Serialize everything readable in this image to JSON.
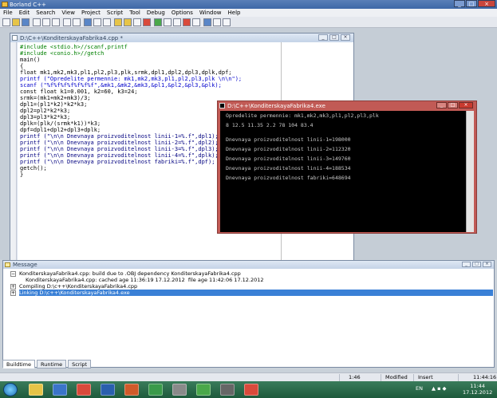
{
  "window": {
    "title": "Borland C++"
  },
  "menu": [
    "File",
    "Edit",
    "Search",
    "View",
    "Project",
    "Script",
    "Tool",
    "Debug",
    "Options",
    "Window",
    "Help"
  ],
  "editor": {
    "title": "D:\\C++\\KonditerskayaFabrika4.cpp *",
    "lines": [
      "#include <stdio.h>//scanf,printf",
      "#include <conio.h>//getch",
      "main()",
      "{",
      "float mk1,mk2,mk3,pl1,pl2,pl3,plk,srmk,dpl1,dpl2,dpl3,dplk,dpf;",
      "printf (\"Opredelite permennie: mk1,mk2,mk3,pl1,pl2,pl3,plk \\n\\n\");",
      "scanf (\"%f%f%f%f%f%f%f\",&mk1,&mk2,&mk3,&pl1,&pl2,&pl3,&plk);",
      "const float k1=0.001, k2=60, k3=24;",
      "srmk=(mk1+mk2+mk3)/3;",
      "dpl1=(pl1*k2)*k2*k3;",
      "dpl2=pl2*k2*k3;",
      "dpl3=pl3*k2*k3;",
      "dplk=(plk/(srmk*k1))*k3;",
      "dpf=dpl1+dpl2+dpl3+dplk;",
      "printf (\"\\n\\n Dnevnaya proizvoditelnost linii-1=%.f\",dpl1);",
      "printf (\"\\n\\n Dnevnaya proizvoditelnost linii-2=%.f\",dpl2);",
      "printf (\"\\n\\n Dnevnaya proizvoditelnost linii-3=%.f\",dpl3);",
      "printf (\"\\n\\n Dnevnaya proizvoditelnost linii-4=%.f\",dplk);",
      "printf (\"\\n\\n Dnevnaya proizvoditelnost fabriki=%.f\",dpf);",
      "getch();",
      "}"
    ]
  },
  "console": {
    "title": "D:\\C++\\KonditerskayaFabrika4.exe",
    "lines": [
      "Opredelite permennie: mk1,mk2,mk3,pl1,pl2,pl3,plk",
      "8 12.5 11.35 2.2 78 104 83.4",
      "Dnevnaya proizvoditelnost linii-1=198000",
      "Dnevnaya proizvoditelnost linii-2=112320",
      "Dnevnaya proizvoditelnost linii-3=149760",
      "Dnevnaya proizvoditelnost linii-4=188534",
      "Dnevnaya proizvoditelnost fabriki=648694"
    ]
  },
  "messages": {
    "title": "Message",
    "lines": [
      "KonditerskayaFabrika4.cpp: build due to .OBJ dependency KonditerskayaFabrika4.cpp",
      "KonditerskayaFabrika4.cpp: cached age 11:36:19 17.12.2012  file age 11:42:06 17.12.2012",
      "Compiling D:\\c++\\KonditerskayaFabrika4.cpp",
      "Linking D:\\c++\\KonditerskayaFabrika4.exe"
    ]
  },
  "tabs": [
    "Buildtime",
    "Runtime",
    "Script"
  ],
  "status": {
    "position": "1:46",
    "state": "Modified",
    "mode": "Insert",
    "time": "11:44:16"
  },
  "tray": {
    "lang": "EN",
    "time": "11:44",
    "date": "17.12.2012"
  }
}
